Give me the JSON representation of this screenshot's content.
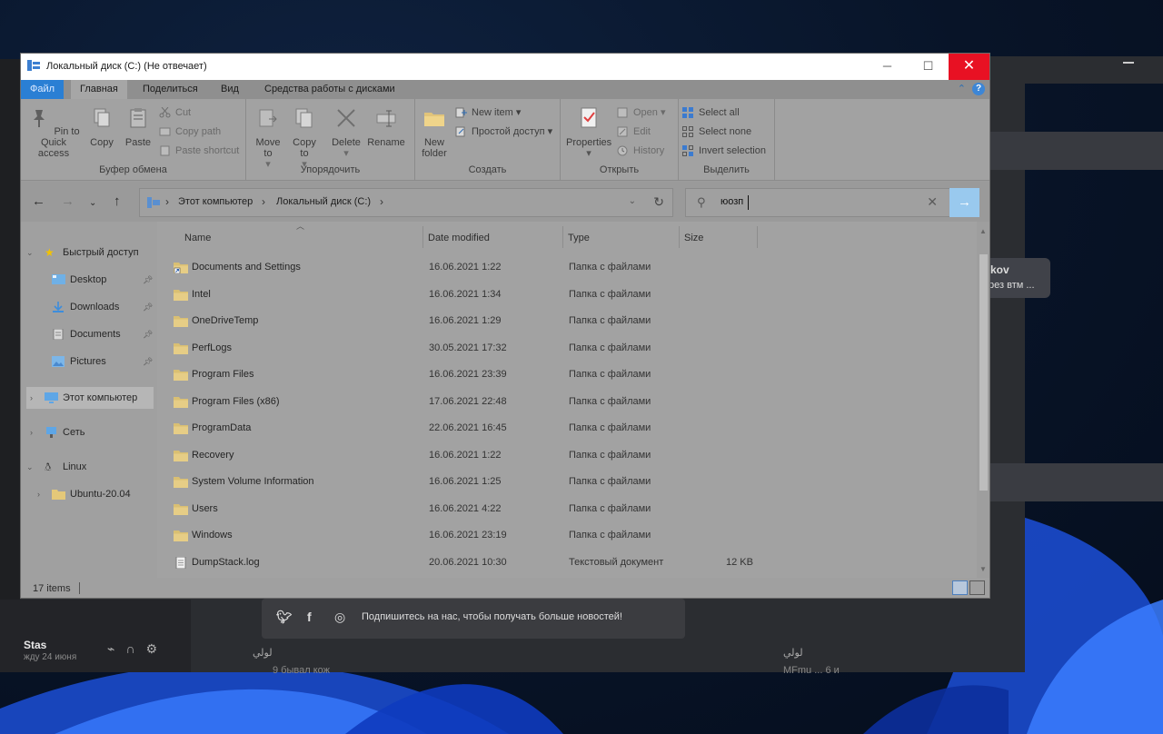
{
  "window": {
    "title": "Локальный диск (C:) (Не отвечает)",
    "controls": {
      "minimize": "─",
      "maximize": "☐",
      "close": "✕"
    }
  },
  "tabs": [
    "Файл",
    "Главная",
    "Поделиться",
    "Вид",
    "Средства работы с дисками"
  ],
  "ribbon": {
    "clipboard": {
      "label": "Буфер обмена",
      "pin": "Pin to Quick access",
      "copy": "Copy",
      "paste": "Paste",
      "cut": "Cut",
      "copy_path": "Copy path",
      "paste_shortcut": "Paste shortcut"
    },
    "organize": {
      "label": "Упорядочить",
      "move_to": "Move to",
      "copy_to": "Copy to",
      "delete": "Delete",
      "rename": "Rename"
    },
    "new": {
      "label": "Создать",
      "new_folder": "New folder",
      "new_item": "New item",
      "easy_access": "Простой доступ"
    },
    "open": {
      "label": "Открыть",
      "properties": "Properties",
      "open": "Open",
      "edit": "Edit",
      "history": "History"
    },
    "select": {
      "label": "Выделить",
      "select_all": "Select all",
      "select_none": "Select none",
      "invert": "Invert selection"
    }
  },
  "address": {
    "crumbs": [
      "Этот компьютер",
      "Локальный диск (C:)"
    ]
  },
  "search": {
    "value": "юозп"
  },
  "nav": {
    "quick_access": "Быстрый доступ",
    "desktop": "Desktop",
    "downloads": "Downloads",
    "documents": "Documents",
    "pictures": "Pictures",
    "this_pc": "Этот компьютер",
    "network": "Сеть",
    "linux": "Linux",
    "ubuntu": "Ubuntu-20.04"
  },
  "columns": {
    "name": "Name",
    "date": "Date modified",
    "type": "Type",
    "size": "Size"
  },
  "files": [
    {
      "name": "Documents and Settings",
      "date": "16.06.2021 1:22",
      "type": "Папка с файлами",
      "size": "",
      "kind": "link-folder"
    },
    {
      "name": "Intel",
      "date": "16.06.2021 1:34",
      "type": "Папка с файлами",
      "size": "",
      "kind": "folder"
    },
    {
      "name": "OneDriveTemp",
      "date": "16.06.2021 1:29",
      "type": "Папка с файлами",
      "size": "",
      "kind": "folder"
    },
    {
      "name": "PerfLogs",
      "date": "30.05.2021 17:32",
      "type": "Папка с файлами",
      "size": "",
      "kind": "folder"
    },
    {
      "name": "Program Files",
      "date": "16.06.2021 23:39",
      "type": "Папка с файлами",
      "size": "",
      "kind": "folder"
    },
    {
      "name": "Program Files (x86)",
      "date": "17.06.2021 22:48",
      "type": "Папка с файлами",
      "size": "",
      "kind": "folder"
    },
    {
      "name": "ProgramData",
      "date": "22.06.2021 16:45",
      "type": "Папка с файлами",
      "size": "",
      "kind": "folder"
    },
    {
      "name": "Recovery",
      "date": "16.06.2021 1:22",
      "type": "Папка с файлами",
      "size": "",
      "kind": "folder"
    },
    {
      "name": "System Volume Information",
      "date": "16.06.2021 1:25",
      "type": "Папка с файлами",
      "size": "",
      "kind": "folder"
    },
    {
      "name": "Users",
      "date": "16.06.2021 4:22",
      "type": "Папка с файлами",
      "size": "",
      "kind": "folder"
    },
    {
      "name": "Windows",
      "date": "16.06.2021 23:19",
      "type": "Папка с файлами",
      "size": "",
      "kind": "folder"
    },
    {
      "name": "DumpStack.log",
      "date": "20.06.2021 10:30",
      "type": "Текстовый документ",
      "size": "12 KB",
      "kind": "file"
    }
  ],
  "status": {
    "count": "17 items"
  },
  "background": {
    "card_name": "kov",
    "card_sub": "рез втм ...",
    "user_name": "Stas",
    "user_sub": "жду 24 июня",
    "social_text": "Подпишитесь на нас, чтобы получать больше новостей!",
    "chat_name_1": "لولي",
    "chat_text_1": "9 бывал кож",
    "chat_name_2": "لولي",
    "chat_text_2": "MFmu ... 6 и"
  },
  "colors": {
    "accent": "#2a7fd4",
    "folder": "#dcc27a",
    "close_red": "#e81123",
    "search_go": "#99c9ee"
  }
}
